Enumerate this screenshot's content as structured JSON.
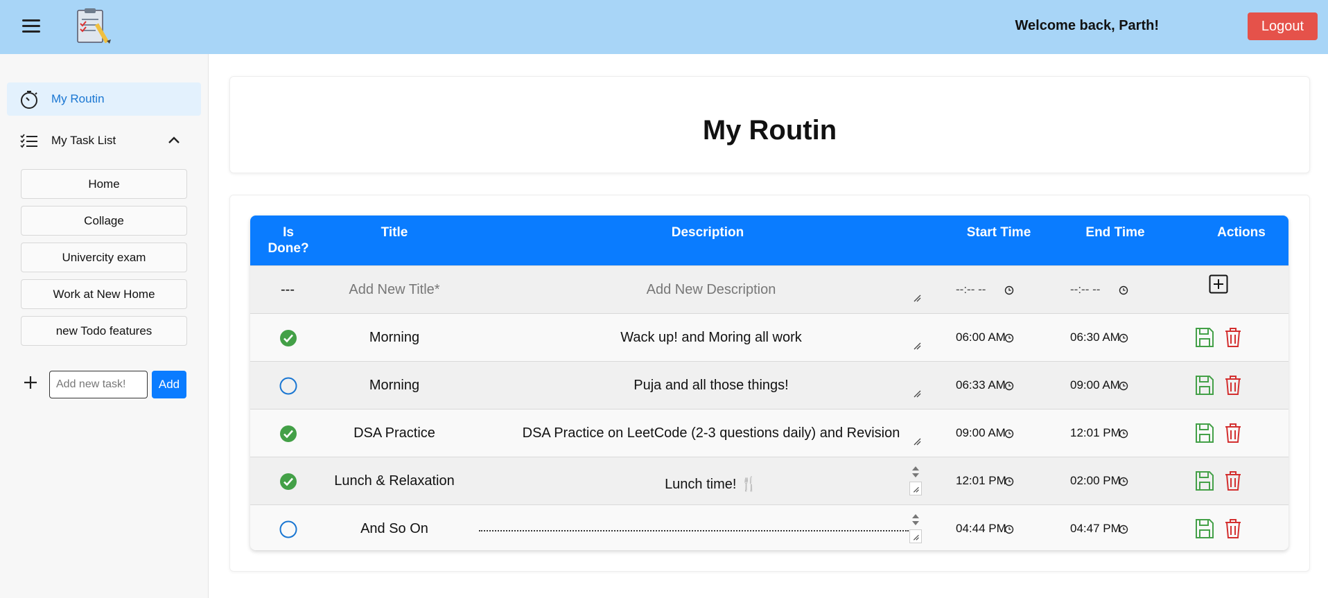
{
  "header": {
    "welcome": "Welcome back, Parth!",
    "logout_label": "Logout"
  },
  "sidebar": {
    "items": [
      {
        "label": "My Routin",
        "icon": "stopwatch-icon"
      },
      {
        "label": "My Task List",
        "icon": "list-icon"
      }
    ],
    "task_lists": [
      "Home",
      "Collage",
      "Univercity exam",
      "Work at New Home",
      "new Todo features"
    ],
    "new_task_placeholder": "Add new task!",
    "add_label": "Add"
  },
  "main": {
    "title": "My Routin",
    "columns": [
      "Is Done?",
      "Title",
      "Description",
      "Start Time",
      "End Time",
      "Actions"
    ],
    "new_row": {
      "done": "---",
      "title_placeholder": "Add New Title*",
      "description_placeholder": "Add New Description",
      "start": "--:-- --",
      "end": "--:-- --"
    },
    "rows": [
      {
        "done": true,
        "title": "Morning",
        "description": "Wack up! and Moring all work",
        "start": "06:00 AM",
        "end": "06:30 AM"
      },
      {
        "done": false,
        "title": "Morning",
        "description": "Puja and all those things!",
        "start": "06:33 AM",
        "end": "09:00 AM"
      },
      {
        "done": true,
        "title": "DSA Practice",
        "description": "DSA Practice on LeetCode (2-3 questions daily) and Revision",
        "start": "09:00 AM",
        "end": "12:01 PM"
      },
      {
        "done": true,
        "title": "Lunch & Relaxation",
        "description": "Lunch time! 🍴",
        "start": "12:01 PM",
        "end": "02:00 PM"
      },
      {
        "done": false,
        "title": "And So On",
        "description": "",
        "start": "04:44 PM",
        "end": "04:47 PM"
      }
    ]
  },
  "colors": {
    "header_bg": "#a8d5f7",
    "accent": "#0a7cff",
    "logout": "#e5524a",
    "done_green": "#43a047",
    "delete_red": "#d32f2f",
    "save_green": "#43a047"
  }
}
